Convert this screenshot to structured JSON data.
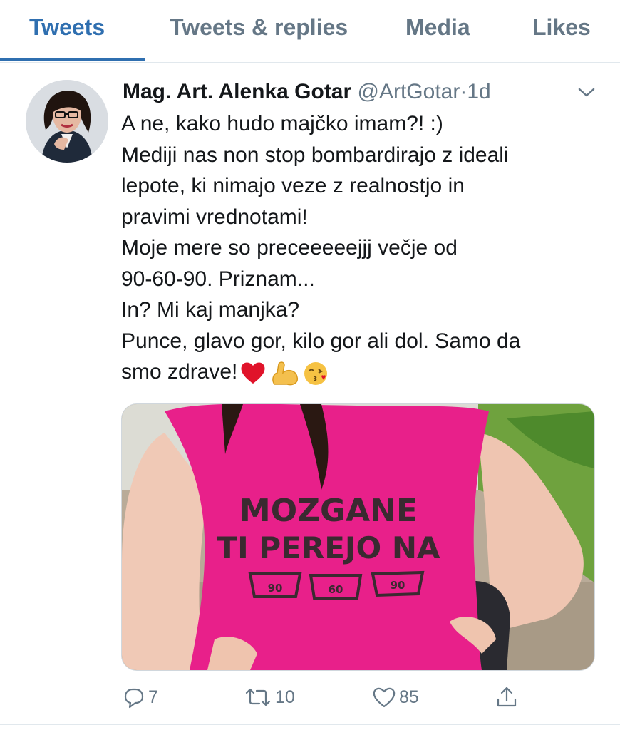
{
  "tabs": [
    {
      "label": "Tweets",
      "active": true
    },
    {
      "label": "Tweets & replies",
      "active": false
    },
    {
      "label": "Media",
      "active": false
    },
    {
      "label": "Likes",
      "active": false
    }
  ],
  "tweet": {
    "display_name": "Mag. Art. Alenka Gotar",
    "handle": "@ArtGotar",
    "separator": "·",
    "time": "1d",
    "lines": [
      "A ne, kako hudo majčko imam?! :)",
      "Mediji nas non stop bombardirajo z ideali",
      "lepote, ki nimajo veze z realnostjo in",
      "pravimi vrednotami!",
      "Moje mere so preceeeeejjj večje od",
      "90-60-90. Priznam...",
      "In? Mi kaj manjka?",
      "Punce, glavo gor, kilo gor ali dol. Samo da",
      "smo zdrave!"
    ],
    "emojis": [
      "red-heart",
      "flexed-biceps",
      "face-blowing-kiss"
    ],
    "image": {
      "shirt_text_line1": "MOZGANE",
      "shirt_text_line2": "TI PEREJO NA",
      "wash_labels": [
        "90",
        "60",
        "90"
      ]
    },
    "actions": {
      "reply_count": "7",
      "retweet_count": "10",
      "like_count": "85"
    }
  },
  "colors": {
    "accent": "#2f6fb0",
    "muted": "#657786",
    "text": "#14171a",
    "shirt": "#e8208a",
    "heart": "#e0132a"
  }
}
